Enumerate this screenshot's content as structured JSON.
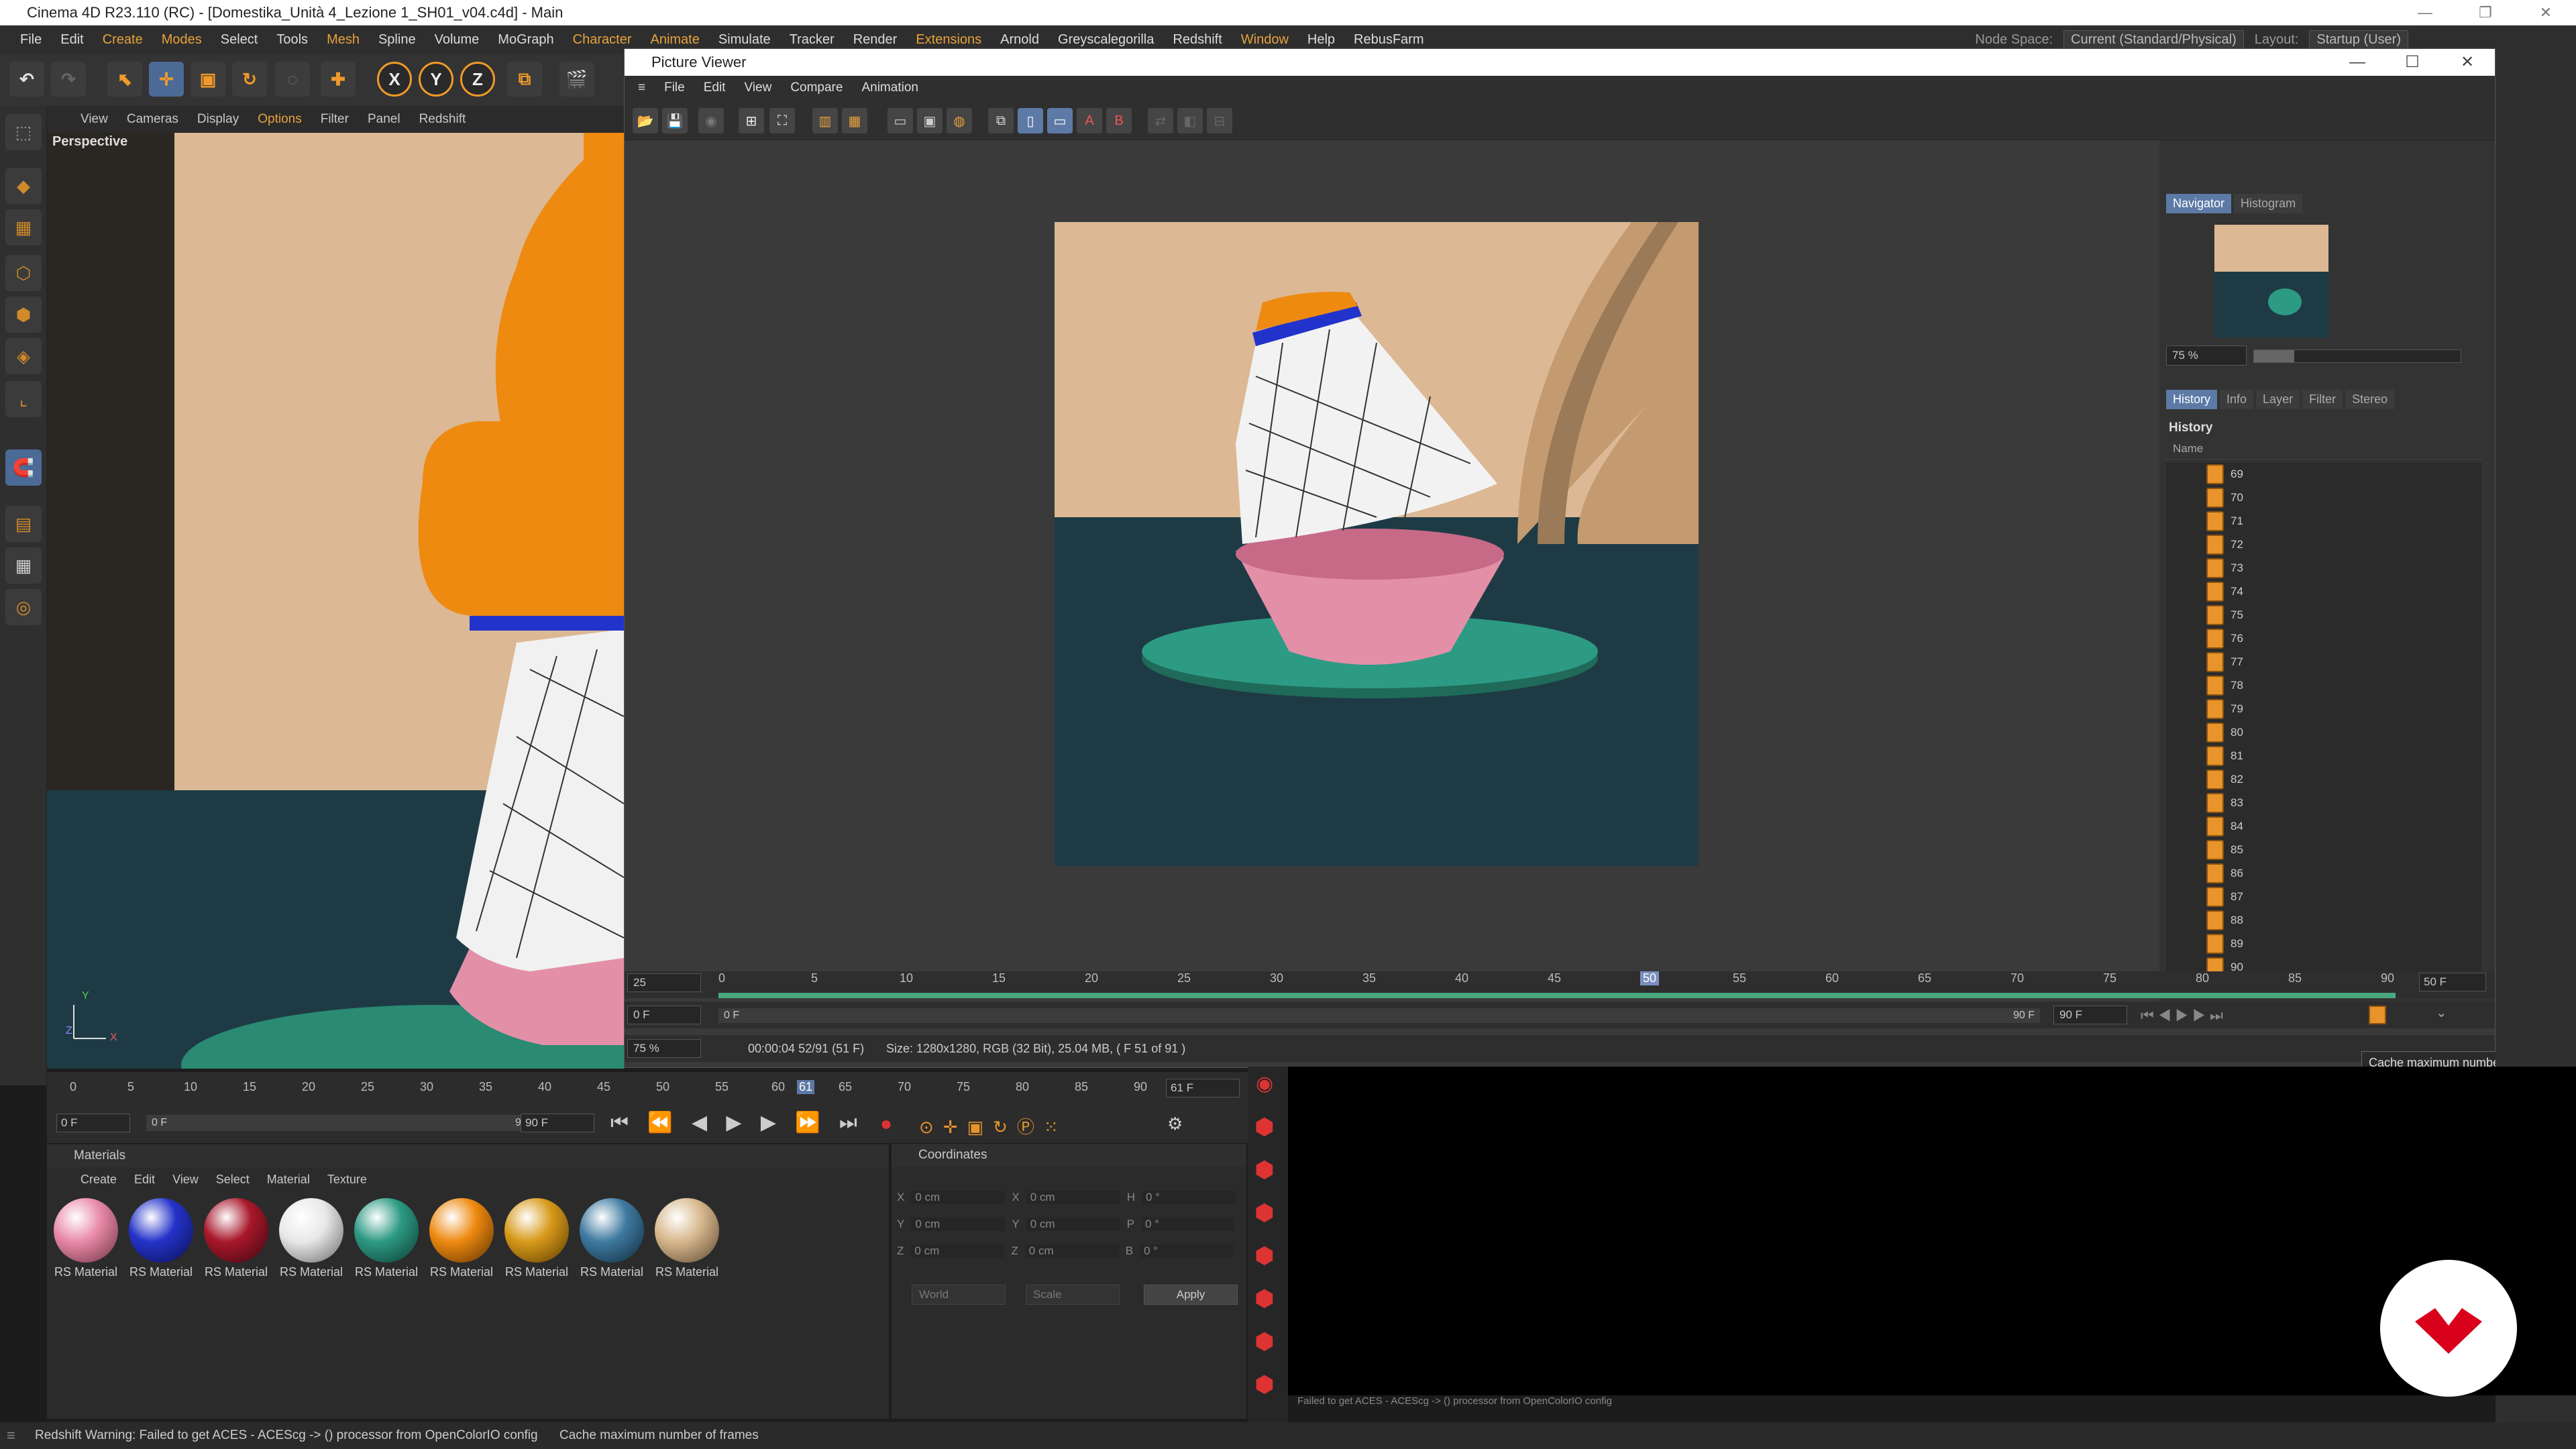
{
  "app": {
    "title": "Cinema 4D R23.110 (RC) - [Domestika_Unità 4_Lezione 1_SH01_v04.c4d] - Main"
  },
  "menu": [
    "File",
    "Edit",
    "Create",
    "Modes",
    "Select",
    "Tools",
    "Mesh",
    "Spline",
    "Volume",
    "MoGraph",
    "Character",
    "Animate",
    "Simulate",
    "Tracker",
    "Render",
    "Extensions",
    "Arnold",
    "Greyscalegorilla",
    "Redshift",
    "Window",
    "Help",
    "RebusFarm"
  ],
  "menu_right": {
    "node_space_label": "Node Space:",
    "node_space_value": "Current (Standard/Physical)",
    "layout_label": "Layout:",
    "layout_value": "Startup (User)"
  },
  "viewport": {
    "menu": [
      "View",
      "Cameras",
      "Display",
      "Options",
      "Filter",
      "Panel",
      "Redshift"
    ],
    "label": "Perspective",
    "axis_y": "Y",
    "axis_x": "X",
    "axis_z": "Z"
  },
  "picture_viewer": {
    "title": "Picture Viewer",
    "menu": [
      "File",
      "Edit",
      "View",
      "Compare",
      "Animation"
    ],
    "tabs_top": [
      "Navigator",
      "Histogram"
    ],
    "zoom": "75 %",
    "tabs_mid": [
      "History",
      "Info",
      "Layer",
      "Filter",
      "Stereo"
    ],
    "history_title": "History",
    "history_col": "Name",
    "history_items": [
      "69",
      "70",
      "71",
      "72",
      "73",
      "74",
      "75",
      "76",
      "77",
      "78",
      "79",
      "80",
      "81",
      "82",
      "83",
      "84",
      "85",
      "86",
      "87",
      "88",
      "89",
      "90"
    ],
    "timeline_start_field": "25",
    "timeline_ticks": [
      "0",
      "5",
      "10",
      "15",
      "20",
      "25",
      "30",
      "35",
      "40",
      "45",
      "50",
      "55",
      "60",
      "65",
      "70",
      "75",
      "80",
      "85",
      "90"
    ],
    "timeline_end_field": "50 F",
    "range_start": "0 F",
    "range_start2": "0 F",
    "range_end": "90 F",
    "range_end2": "90 F",
    "status_zoom": "75 %",
    "status_text": "00:00:04 52/91 (51 F)",
    "status_size": "Size: 1280x1280, RGB (32 Bit), 25.04 MB,  ( F 51 of 91 )",
    "tooltip": "Cache maximum number of frames"
  },
  "timeline": {
    "ticks": [
      "0",
      "5",
      "10",
      "15",
      "20",
      "25",
      "30",
      "35",
      "40",
      "45",
      "50",
      "55",
      "60",
      "61",
      "65",
      "70",
      "75",
      "80",
      "85",
      "90"
    ],
    "current": "61 F",
    "start": "0 F",
    "start2": "0 F",
    "end": "90 F",
    "end2": "90 F"
  },
  "materials": {
    "title": "Materials",
    "menu": [
      "Create",
      "Edit",
      "View",
      "Select",
      "Material",
      "Texture"
    ],
    "items": [
      {
        "label": "RS Material",
        "color": "#e98aa9"
      },
      {
        "label": "RS Material",
        "color": "#2433c9"
      },
      {
        "label": "RS Material",
        "color": "#a8172a"
      },
      {
        "label": "RS Material",
        "color": "#e8e8e8"
      },
      {
        "label": "RS Material",
        "color": "#2d9a84"
      },
      {
        "label": "RS Material",
        "color": "#ee8a10"
      },
      {
        "label": "RS Material",
        "color": "#d89a1a"
      },
      {
        "label": "RS Material",
        "color": "#3f7aa1"
      },
      {
        "label": "RS Material",
        "color": "#d8b88e"
      }
    ]
  },
  "coordinates": {
    "title": "Coordinates",
    "rows": [
      {
        "a": "X",
        "av": "0 cm",
        "b": "X",
        "bv": "0 cm",
        "c": "H",
        "cv": "0 °"
      },
      {
        "a": "Y",
        "av": "0 cm",
        "b": "Y",
        "bv": "0 cm",
        "c": "P",
        "cv": "0 °"
      },
      {
        "a": "Z",
        "av": "0 cm",
        "b": "Z",
        "bv": "0 cm",
        "c": "B",
        "cv": "0 °"
      }
    ],
    "world": "World",
    "scale": "Scale",
    "apply": "Apply"
  },
  "log": {
    "text": "Failed to get ACES - ACEScg -> () processor from OpenColorIO config"
  },
  "statusbar": {
    "warning": "Redshift Warning: Failed to get ACES - ACEScg -> () processor from OpenColorIO config",
    "hint": "Cache maximum number of frames"
  },
  "colors": {
    "accent": "#5d7aa6",
    "orange": "#e8942a",
    "timeline_green": "#4aa880",
    "logo_red": "#d9001b"
  }
}
